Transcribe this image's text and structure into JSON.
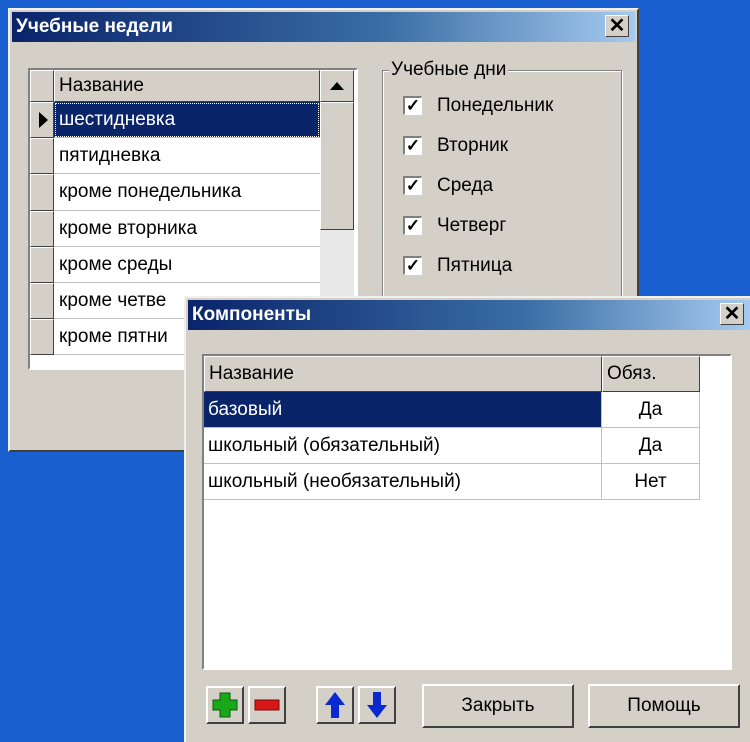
{
  "weeks_window": {
    "title": "Учебные недели",
    "close_glyph": "✕",
    "list": {
      "column_header": "Название",
      "rows": [
        "шестидневка",
        "пятидневка",
        "кроме понедельника",
        "кроме вторника",
        "кроме среды",
        "кроме четве",
        "кроме пятни"
      ],
      "selected_index": 0
    },
    "days_group": {
      "label": "Учебные дни",
      "days": [
        {
          "label": "Понедельник",
          "checked": true
        },
        {
          "label": "Вторник",
          "checked": true
        },
        {
          "label": "Среда",
          "checked": true
        },
        {
          "label": "Четверг",
          "checked": true
        },
        {
          "label": "Пятница",
          "checked": true
        }
      ]
    }
  },
  "components_window": {
    "title": "Компоненты",
    "close_glyph": "✕",
    "table": {
      "headers": {
        "name": "Название",
        "required": "Обяз."
      },
      "rows": [
        {
          "name": "базовый",
          "required": "Да"
        },
        {
          "name": "школьный (обязательный)",
          "required": "Да"
        },
        {
          "name": "школьный (необязательный)",
          "required": "Нет"
        }
      ],
      "selected_index": 0
    },
    "buttons": {
      "close_label": "Закрыть",
      "help_label": "Помощь"
    },
    "icons": [
      "plus-icon",
      "minus-icon",
      "arrow-up-icon",
      "arrow-down-icon"
    ],
    "colors": {
      "plus": "#18a818",
      "minus": "#d81818",
      "arrows": "#0a2ad0"
    }
  },
  "theme": {
    "desktop": "#1a5fd0",
    "selection": "#0a246a"
  }
}
